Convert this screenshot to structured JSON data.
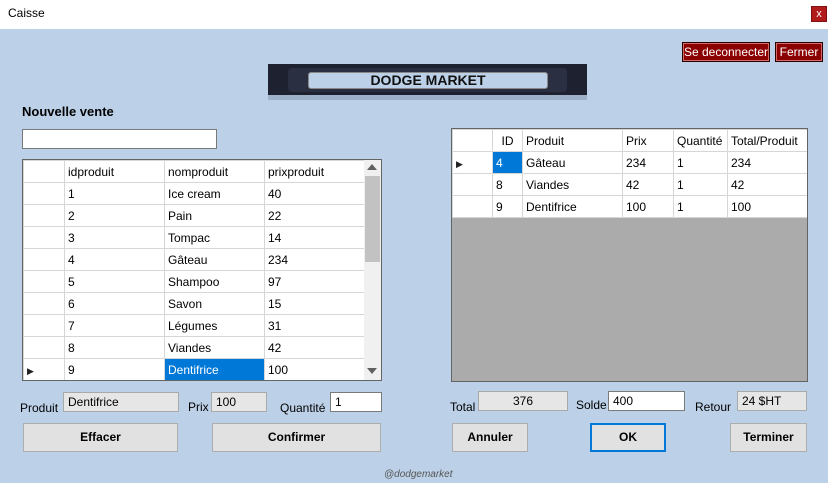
{
  "window": {
    "title": "Caisse",
    "close_label": "x"
  },
  "header": {
    "logout_label": "Se deconnecter",
    "close_label": "Fermer",
    "banner_text": "DODGE MARKET"
  },
  "sale": {
    "title": "Nouvelle vente",
    "search_value": "",
    "products": {
      "columns": [
        "idproduit",
        "nomproduit",
        "prixproduit"
      ],
      "rows": [
        [
          "1",
          "Ice cream",
          "40"
        ],
        [
          "2",
          "Pain",
          "22"
        ],
        [
          "3",
          "Tompac",
          "14"
        ],
        [
          "4",
          "Gâteau",
          "234"
        ],
        [
          "5",
          "Shampoo",
          "97"
        ],
        [
          "6",
          "Savon",
          "15"
        ],
        [
          "7",
          "Légumes",
          "31"
        ],
        [
          "8",
          "Viandes",
          "42"
        ],
        [
          "9",
          "Dentifrice",
          "100"
        ]
      ],
      "current_row_marker": "▶"
    },
    "product_label": "Produit",
    "product_value": "Dentifrice",
    "price_label": "Prix",
    "price_value": "100",
    "quantity_label": "Quantité",
    "quantity_value": "1",
    "clear_label": "Effacer",
    "confirm_label": "Confirmer"
  },
  "cart": {
    "columns": [
      "ID",
      "Produit",
      "Prix",
      "Quantité",
      "Total/Produit"
    ],
    "rows": [
      [
        "4",
        "Gâteau",
        "234",
        "1",
        "234"
      ],
      [
        "8",
        "Viandes",
        "42",
        "1",
        "42"
      ],
      [
        "9",
        "Dentifrice",
        "100",
        "1",
        "100"
      ]
    ],
    "current_row_marker": "▶",
    "total_label": "Total",
    "total_value": "376",
    "balance_label": "Solde",
    "balance_value": "400",
    "change_label": "Retour",
    "change_value": "24 $HT",
    "cancel_label": "Annuler",
    "ok_label": "OK",
    "finish_label": "Terminer"
  },
  "footer": {
    "credit": "@dodgemarket"
  },
  "colors": {
    "background": "#bcd1e8",
    "selection": "#0078d7",
    "danger": "#8b0000"
  }
}
